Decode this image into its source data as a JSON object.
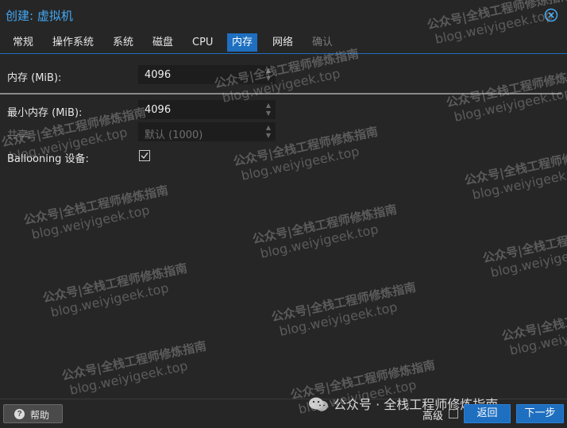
{
  "window": {
    "title": "创建: 虚拟机",
    "close_icon": "close-circle-icon"
  },
  "tabs": [
    {
      "label": "常规",
      "state": "normal"
    },
    {
      "label": "操作系统",
      "state": "normal"
    },
    {
      "label": "系统",
      "state": "normal"
    },
    {
      "label": "磁盘",
      "state": "normal"
    },
    {
      "label": "CPU",
      "state": "normal"
    },
    {
      "label": "内存",
      "state": "active"
    },
    {
      "label": "网络",
      "state": "normal"
    },
    {
      "label": "确认",
      "state": "disabled"
    }
  ],
  "form": {
    "memory": {
      "label": "内存 (MiB):",
      "value": "4096"
    },
    "min_memory": {
      "label": "最小内存 (MiB):",
      "value": "4096"
    },
    "shares": {
      "label": "共享:",
      "value": "默认 (1000)"
    },
    "ballooning": {
      "label": "Ballooning 设备:",
      "checked": true
    }
  },
  "watermark": {
    "line1": "公众号|全栈工程师修炼指南",
    "line2": "blog.weiyigeek.top"
  },
  "footer": {
    "help_label": "帮助",
    "wechat_text": "公众号 · 全栈工程师修炼指南",
    "advanced_label": "高级",
    "advanced_checked": false,
    "back_label": "返回",
    "next_label": "下一步"
  },
  "colors": {
    "accent": "#1e6fc0",
    "title": "#44a9f5",
    "background": "#262626"
  }
}
